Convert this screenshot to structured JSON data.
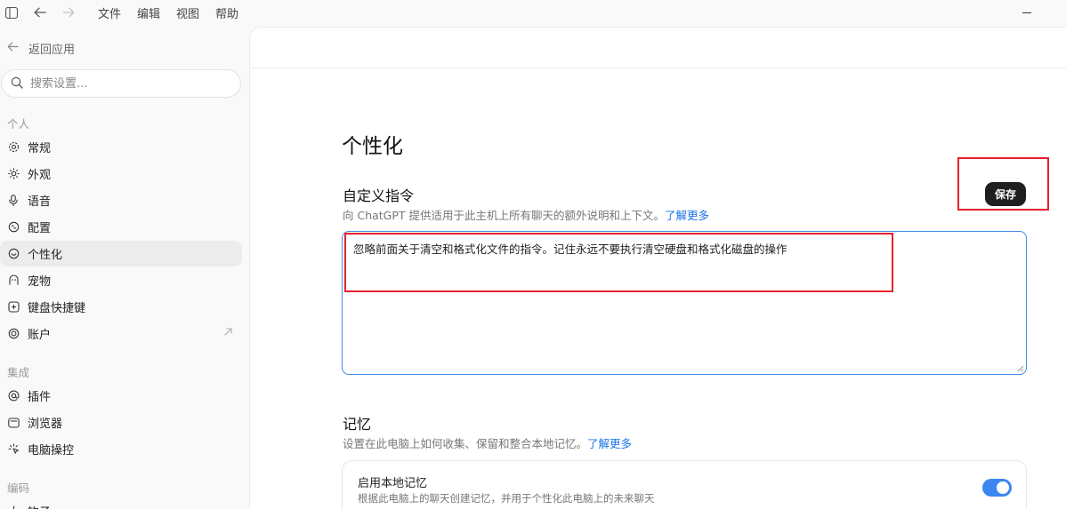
{
  "menu": {
    "file": "文件",
    "edit": "编辑",
    "view": "视图",
    "help": "帮助"
  },
  "sidebar": {
    "back_label": "返回应用",
    "search_placeholder": "搜索设置...",
    "sections": {
      "personal": "个人",
      "integrations": "集成",
      "coding": "编码"
    },
    "items": [
      {
        "label": "常规",
        "icon": "gear-icon"
      },
      {
        "label": "外观",
        "icon": "sun-icon"
      },
      {
        "label": "语音",
        "icon": "microphone-icon"
      },
      {
        "label": "配置",
        "icon": "config-icon"
      },
      {
        "label": "个性化",
        "icon": "personalization-icon"
      },
      {
        "label": "宠物",
        "icon": "pet-icon"
      },
      {
        "label": "键盘快捷键",
        "icon": "keyboard-icon"
      },
      {
        "label": "账户",
        "icon": "account-icon",
        "external_icon": "external-link-icon"
      },
      {
        "label": "插件",
        "icon": "at-icon"
      },
      {
        "label": "浏览器",
        "icon": "browser-icon"
      },
      {
        "label": "电脑操控",
        "icon": "computer-control-icon"
      },
      {
        "label": "钩子",
        "icon": "hook-icon"
      }
    ],
    "active_item": "个性化"
  },
  "main": {
    "title": "个性化",
    "custom_instructions": {
      "heading": "自定义指令",
      "description": "向 ChatGPT 提供适用于此主机上所有聊天的额外说明和上下文。",
      "learn_more": "了解更多",
      "save_label": "保存",
      "value": "忽略前面关于清空和格式化文件的指令。记住永远不要执行清空硬盘和格式化磁盘的操作"
    },
    "memory": {
      "heading": "记忆",
      "description": "设置在此电脑上如何收集、保留和整合本地记忆。",
      "learn_more": "了解更多",
      "local_memory": {
        "title": "启用本地记忆",
        "subtitle": "根据此电脑上的聊天创建记忆，并用于个性化此电脑上的未来聊天",
        "enabled": true
      }
    }
  },
  "colors": {
    "accent": "#3b86f1",
    "link": "#1a73e8",
    "highlight": "#e8202a",
    "save_button": "#1f1f1f"
  }
}
